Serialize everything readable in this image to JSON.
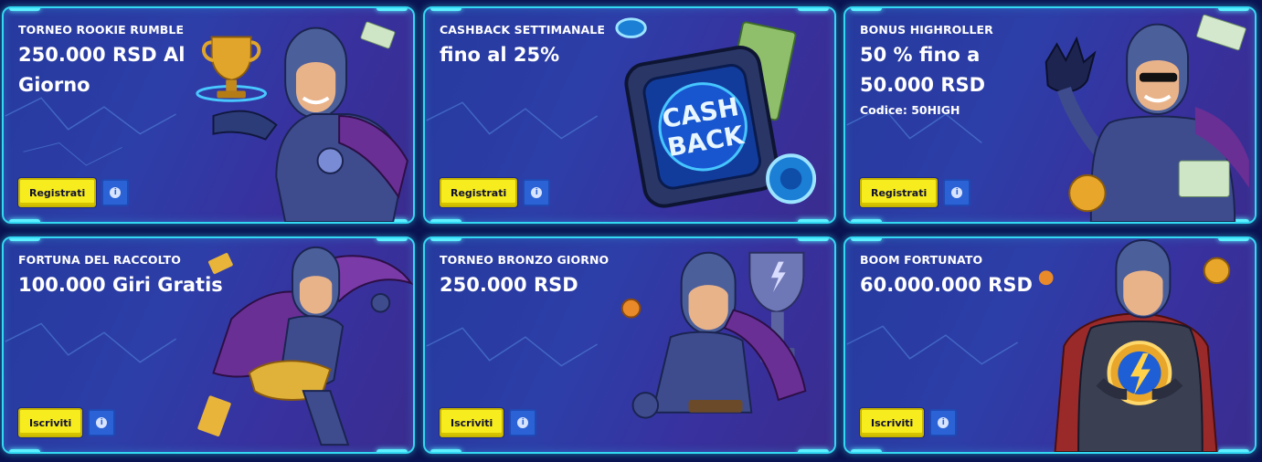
{
  "promotions": [
    {
      "kicker": "TORNEO ROOKIE RUMBLE",
      "headline": "250.000 RSD Al Giorno",
      "code": "",
      "cta": "Registrati",
      "art_icon": "trophy-hero-icon"
    },
    {
      "kicker": "CASHBACK SETTIMANALE",
      "headline": "fino al 25%",
      "code": "",
      "cta": "Registrati",
      "art_icon": "cashback-device-icon",
      "art_text_1": "CASH",
      "art_text_2": "BACK"
    },
    {
      "kicker": "BONUS HIGHROLLER",
      "headline": "50 % fino a 50.000 RSD",
      "code": "Codice: 50HIGH",
      "cta": "Registrati",
      "art_icon": "sunglasses-hero-icon"
    },
    {
      "kicker": "FORTUNA DEL RACCOLTO",
      "headline": "100.000 Giri Gratis",
      "code": "",
      "cta": "Iscriviti",
      "art_icon": "flying-hero-icon"
    },
    {
      "kicker": "TORNEO BRONZO GIORNO",
      "headline": "250.000 RSD",
      "code": "",
      "cta": "Iscriviti",
      "art_icon": "trophy-hero-icon"
    },
    {
      "kicker": "BOOM FORTUNATO",
      "headline": "60.000.000 RSD",
      "code": "",
      "cta": "Iscriviti",
      "art_icon": "lightning-orb-hero-icon"
    }
  ],
  "info_icon": "i",
  "colors": {
    "border": "#33d8f2",
    "cta_bg": "#f6ec1e",
    "info_bg": "#2b63d6",
    "card_bg": "#2d3ea8",
    "page_bg": "#0b1452"
  }
}
